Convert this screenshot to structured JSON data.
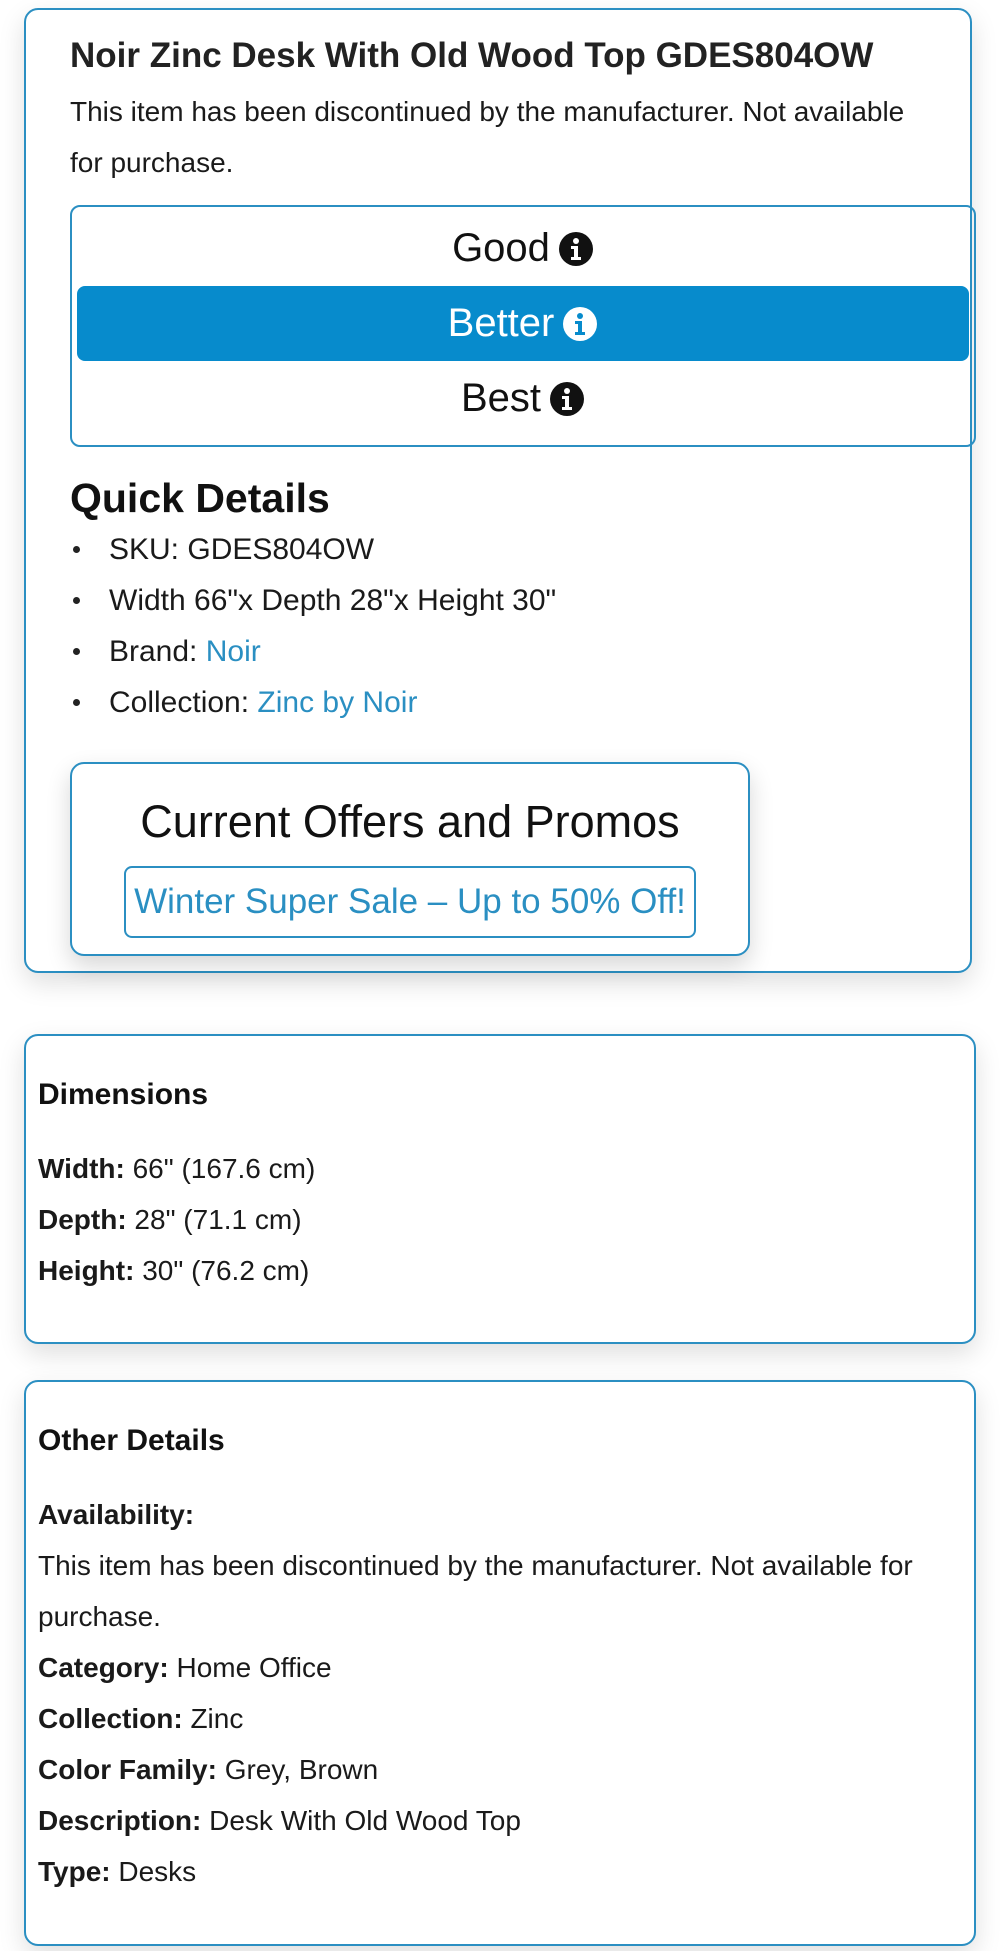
{
  "product": {
    "title": "Noir Zinc Desk With Old Wood Top GDES804OW",
    "discontinued_notice": "This item has been discontinued by the manufacturer. Not available for purchase."
  },
  "tiers": [
    {
      "label": "Good",
      "selected": false
    },
    {
      "label": "Better",
      "selected": true
    },
    {
      "label": "Best",
      "selected": false
    }
  ],
  "quick_details": {
    "heading": "Quick Details",
    "sku": "SKU: GDES804OW",
    "size": "Width 66\"x Depth 28\"x Height 30\"",
    "brand_label": "Brand: ",
    "brand_value": "Noir",
    "collection_label": "Collection: ",
    "collection_value": "Zinc by Noir"
  },
  "offers": {
    "title": "Current Offers and Promos",
    "promo": "Winter Super Sale – Up to 50% Off!"
  },
  "dimensions": {
    "heading": "Dimensions",
    "rows": [
      {
        "label": "Width:",
        "value": " 66\" (167.6 cm)"
      },
      {
        "label": "Depth:",
        "value": " 28\" (71.1 cm)"
      },
      {
        "label": "Height:",
        "value": " 30\" (76.2 cm)"
      }
    ]
  },
  "other_details": {
    "heading": "Other Details",
    "availability_label": "Availability:",
    "availability_value": "This item has been discontinued by the manufacturer. Not available for purchase.",
    "rows": [
      {
        "label": "Category:",
        "value": " Home Office"
      },
      {
        "label": "Collection:",
        "value": " Zinc"
      },
      {
        "label": "Color Family:",
        "value": " Grey, Brown"
      },
      {
        "label": "Description:",
        "value": " Desk With Old Wood Top"
      },
      {
        "label": "Type:",
        "value": " Desks"
      }
    ]
  },
  "colors": {
    "accent": "#2b8fc2",
    "selected_tier_bg": "#078bcc",
    "link": "#2a8fc2"
  },
  "icons": {
    "tier_info": "info-circle-icon"
  }
}
